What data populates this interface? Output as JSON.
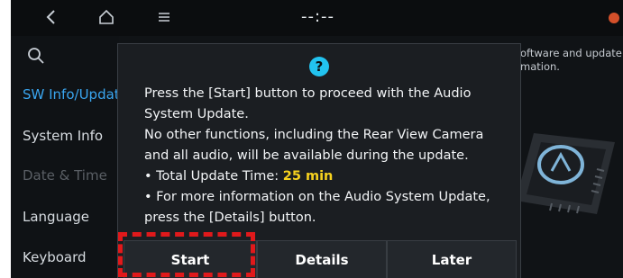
{
  "topbar": {
    "back_icon": "chevron-left",
    "home_icon": "home",
    "menu_icon": "menu",
    "clock": "--:--"
  },
  "sidebar": {
    "items": [
      {
        "label": "SW Info/Update",
        "state": "active"
      },
      {
        "label": "System Info",
        "state": "normal"
      },
      {
        "label": "Date & Time",
        "state": "disabled"
      },
      {
        "label": "Language",
        "state": "normal"
      },
      {
        "label": "Keyboard",
        "state": "normal"
      }
    ]
  },
  "background_text": {
    "line1": "oftware and update",
    "line2": "mation."
  },
  "dialog": {
    "icon": "question",
    "icon_text": "?",
    "line1": "Press the [Start] button to proceed with the Audio System Update.",
    "line2": "No other functions, including the Rear View Camera and all audio, will be available during the update.",
    "bullet1_prefix": "• Total Update Time: ",
    "bullet1_value": "25 min",
    "bullet2": "• For more information on the Audio System Update, press the [Details] button.",
    "buttons": {
      "start": "Start",
      "details": "Details",
      "later": "Later"
    }
  },
  "colors": {
    "accent_blue": "#3aa6f0",
    "highlight_yellow": "#f7d21e",
    "callout_red": "#e0191b"
  }
}
